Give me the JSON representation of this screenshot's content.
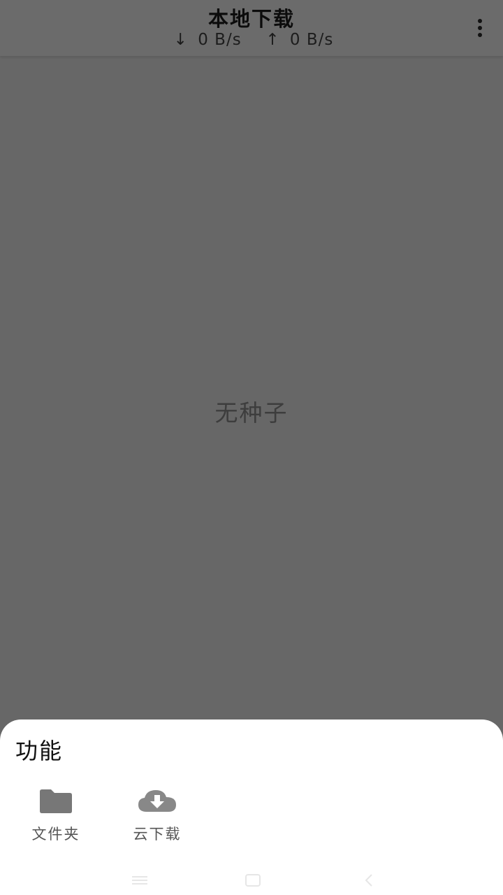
{
  "header": {
    "title": "本地下载",
    "download_speed": "0 B/s",
    "upload_speed": "0 B/s",
    "download_arrow": "↓",
    "upload_arrow": "↑",
    "menu_icon": "more-vert-icon"
  },
  "empty_state": {
    "text": "无种子"
  },
  "bottom_sheet": {
    "title": "功能",
    "actions": [
      {
        "label": "文件夹",
        "icon": "folder-icon"
      },
      {
        "label": "云下载",
        "icon": "cloud-download-icon"
      }
    ]
  },
  "nav_bar": {
    "icons": [
      "menu-icon",
      "home-icon",
      "back-icon"
    ]
  },
  "colors": {
    "scrim": "#676767",
    "sheet_background": "#ffffff",
    "icon_gray": "#777777"
  }
}
